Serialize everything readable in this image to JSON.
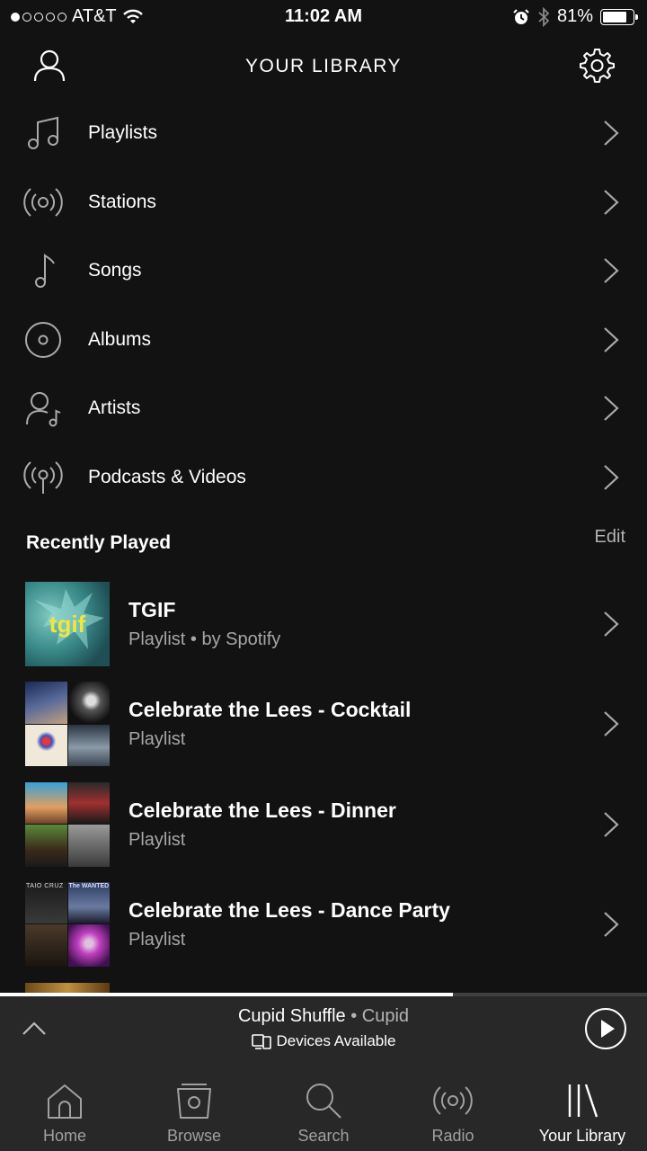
{
  "status_bar": {
    "carrier": "AT&T",
    "time": "11:02 AM",
    "battery": "81%",
    "battery_level": 0.81
  },
  "header": {
    "title": "YOUR LIBRARY"
  },
  "menu": [
    {
      "label": "Playlists",
      "icon": "music-notes-icon"
    },
    {
      "label": "Stations",
      "icon": "radio-waves-icon"
    },
    {
      "label": "Songs",
      "icon": "music-note-icon"
    },
    {
      "label": "Albums",
      "icon": "album-disc-icon"
    },
    {
      "label": "Artists",
      "icon": "artist-icon"
    },
    {
      "label": "Podcasts & Videos",
      "icon": "podcast-icon"
    }
  ],
  "recently_played": {
    "label": "Recently Played",
    "edit": "Edit",
    "items": [
      {
        "title": "TGIF",
        "subtitle": "Playlist • by Spotify",
        "art_text": "tgif"
      },
      {
        "title": "Celebrate the Lees - Cocktail",
        "subtitle": "Playlist"
      },
      {
        "title": "Celebrate the Lees - Dinner",
        "subtitle": "Playlist"
      },
      {
        "title": "Celebrate the Lees - Dance Party",
        "subtitle": "Playlist",
        "art_labels": [
          "TAIO CRUZ",
          "The WANTED"
        ]
      }
    ]
  },
  "now_playing": {
    "track": "Cupid Shuffle",
    "separator": " • ",
    "artist": "Cupid",
    "devices": "Devices Available",
    "progress": 0.7
  },
  "tabs": [
    {
      "label": "Home",
      "icon": "home-icon",
      "active": false
    },
    {
      "label": "Browse",
      "icon": "browse-icon",
      "active": false
    },
    {
      "label": "Search",
      "icon": "search-icon",
      "active": false
    },
    {
      "label": "Radio",
      "icon": "radio-icon",
      "active": false
    },
    {
      "label": "Your Library",
      "icon": "library-icon",
      "active": true
    }
  ],
  "colors": {
    "background": "#121212",
    "bar": "#282828",
    "tgif_text": "#f2e63a"
  }
}
